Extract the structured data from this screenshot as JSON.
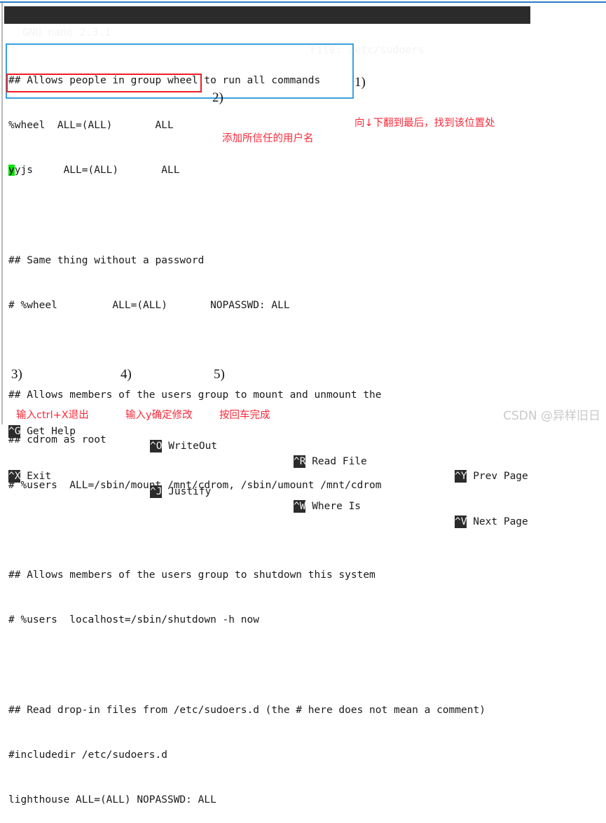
{
  "window": {
    "title_app": "GNU nano 2.3.1",
    "title_file": "File: /etc/sudoers"
  },
  "editor": {
    "cursor_char": "y",
    "lines": [
      "## Allows people in group wheel to run all commands",
      "%wheel  ALL=(ALL)       ALL",
      "yjs     ALL=(ALL)       ALL",
      "",
      "## Same thing without a password",
      "# %wheel         ALL=(ALL)       NOPASSWD: ALL",
      "",
      "## Allows members of the users group to mount and unmount the",
      "## cdrom as root",
      "# %users  ALL=/sbin/mount /mnt/cdrom, /sbin/umount /mnt/cdrom",
      "",
      "## Allows members of the users group to shutdown this system",
      "# %users  localhost=/sbin/shutdown -h now",
      "",
      "## Read drop-in files from /etc/sudoers.d (the # here does not mean a comment)",
      "#includedir /etc/sudoers.d",
      "lighthouse ALL=(ALL) NOPASSWD: ALL"
    ]
  },
  "annotations": [
    {
      "num": "1)",
      "text": "向↓下翻到最后，找到该位置处"
    },
    {
      "num": "2)",
      "text": "添加所信任的用户名"
    },
    {
      "num": "3)",
      "text": "输入ctrl+X退出"
    },
    {
      "num": "4)",
      "text": "输入y确定修改"
    },
    {
      "num": "5)",
      "text": "按回车完成"
    }
  ],
  "colors": {
    "annotation_red": "#fb2a3a",
    "highlight_blue": "#37a2e0",
    "highlight_red": "#ed1c24",
    "cursor_green": "#00e400",
    "title_bar_bg": "#2b2b2b",
    "top_rule_blue": "#2e7cc4"
  },
  "help_bar": {
    "row1": [
      {
        "key": "^G",
        "label": " Get Help"
      },
      {
        "key": "^O",
        "label": " WriteOut"
      },
      {
        "key": "^R",
        "label": " Read File"
      },
      {
        "key": "^Y",
        "label": " Prev Page"
      }
    ],
    "row2": [
      {
        "key": "^X",
        "label": " Exit"
      },
      {
        "key": "^J",
        "label": " Justify"
      },
      {
        "key": "^W",
        "label": " Where Is"
      },
      {
        "key": "^V",
        "label": " Next Page"
      }
    ]
  },
  "watermark": "CSDN @异样旧日"
}
